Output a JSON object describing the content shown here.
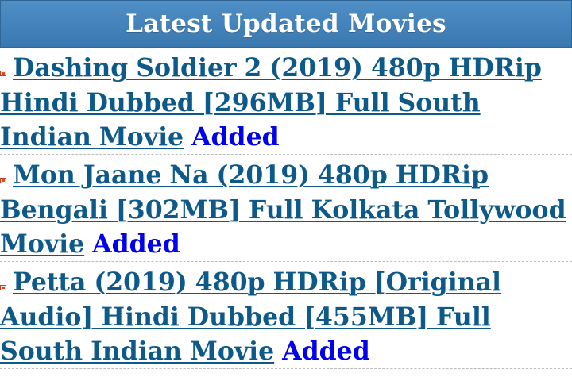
{
  "header": {
    "title": "Latest Updated Movies"
  },
  "movies": [
    {
      "title": "Dashing Soldier 2 (2019) 480p HDRip Hindi Dubbed [296MB] Full South Indian Movie",
      "status": "Added"
    },
    {
      "title": "Mon Jaane Na (2019) 480p HDRip Bengali [302MB] Full Kolkata Tollywood Movie",
      "status": "Added"
    },
    {
      "title": "Petta (2019) 480p HDRip [Original Audio] Hindi Dubbed [455MB] Full South Indian Movie",
      "status": "Added"
    }
  ],
  "icons": {
    "bullet": "new-badge-icon"
  },
  "colors": {
    "header_bg": "#3a78b0",
    "link": "#0d5a8a",
    "status": "#0000ee"
  }
}
